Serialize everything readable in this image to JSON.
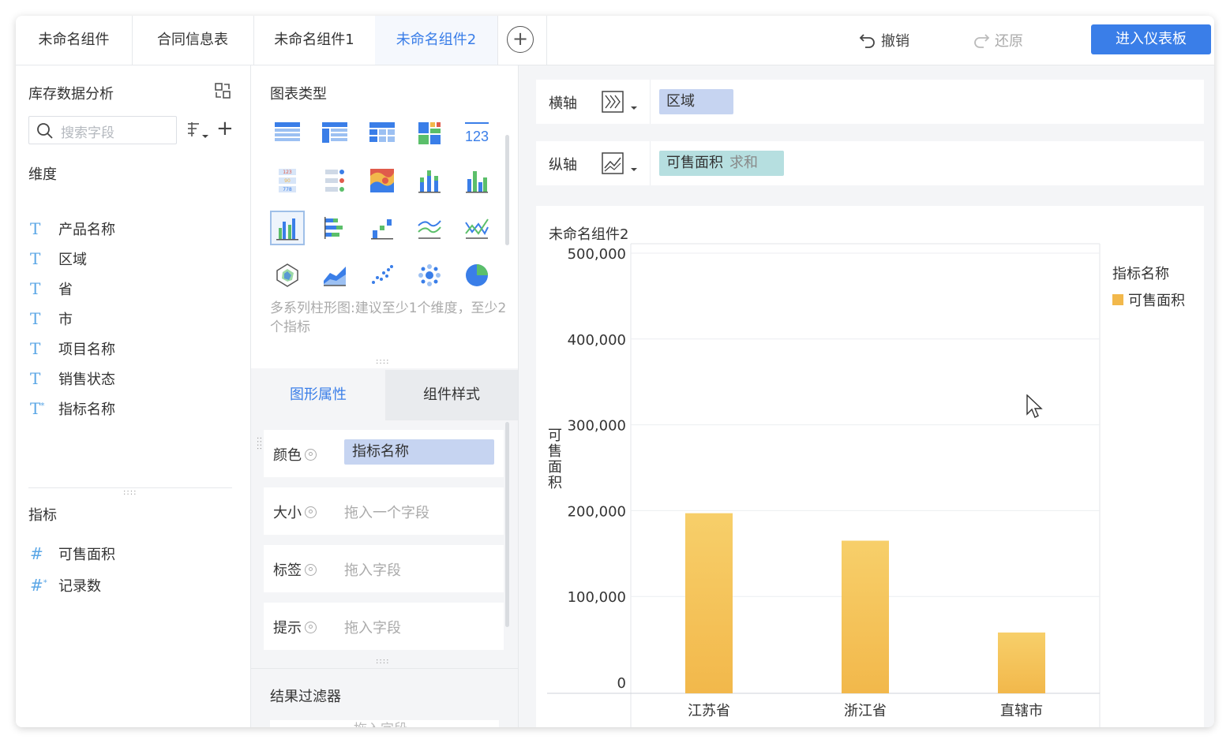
{
  "tabs": [
    {
      "label": "未命名组件",
      "active": false
    },
    {
      "label": "合同信息表",
      "active": false
    },
    {
      "label": "未命名组件1",
      "active": false
    },
    {
      "label": "未命名组件2",
      "active": true
    }
  ],
  "toolbar": {
    "undo_label": "撤销",
    "redo_label": "还原",
    "enter_dashboard_label": "进入仪表板",
    "accent": "#3a7ee8"
  },
  "left_panel": {
    "dataset_title": "库存数据分析",
    "search_placeholder": "搜索字段",
    "dimensions_label": "维度",
    "dimensions": [
      {
        "type": "T",
        "label": "产品名称"
      },
      {
        "type": "T",
        "label": "区域"
      },
      {
        "type": "T",
        "label": "省"
      },
      {
        "type": "T",
        "label": "市"
      },
      {
        "type": "T",
        "label": "项目名称"
      },
      {
        "type": "T",
        "label": "销售状态"
      },
      {
        "type": "T*",
        "label": "指标名称"
      }
    ],
    "measures_label": "指标",
    "measures": [
      {
        "type": "#",
        "label": "可售面积"
      },
      {
        "type": "#*",
        "label": "记录数"
      }
    ]
  },
  "middle_panel": {
    "chart_types_title": "图表类型",
    "chart_types_hint": "多系列柱形图:建议至少1个维度，至少2个指标",
    "property_tabs": {
      "shape": "图形属性",
      "style": "组件样式"
    },
    "properties": {
      "color_label": "颜色",
      "color_value": "指标名称",
      "size_label": "大小",
      "size_placeholder": "拖入一个字段",
      "label_label": "标签",
      "label_placeholder": "拖入字段",
      "tooltip_label": "提示",
      "tooltip_placeholder": "拖入字段"
    },
    "filter_title": "结果过滤器",
    "filter_placeholder": "拖入字段"
  },
  "axes": {
    "x_label": "横轴",
    "x_field": "区域",
    "y_label": "纵轴",
    "y_field": "可售面积",
    "y_agg": "求和"
  },
  "chart_panel_title": "未命名组件2",
  "chart_data": {
    "type": "bar",
    "categories": [
      "江苏省",
      "浙江省",
      "直辖市"
    ],
    "series": [
      {
        "name": "可售面积",
        "values": [
          197000,
          165000,
          58000
        ],
        "color": "#f2b84b"
      }
    ],
    "xlabel": "区域",
    "ylabel": "可售面积",
    "ylim": [
      0,
      500000
    ],
    "yticks": [
      "0",
      "100,000",
      "200,000",
      "300,000",
      "400,000",
      "500,000"
    ],
    "legend_title": "指标名称",
    "legend_position": "right",
    "grid": true
  }
}
